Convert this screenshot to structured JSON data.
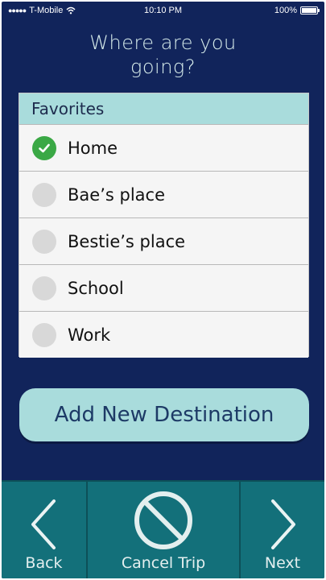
{
  "status": {
    "carrier": "T-Mobile",
    "time": "10:10 PM",
    "battery": "100%"
  },
  "header": {
    "title_line1": "Where are you",
    "title_line2": "going?"
  },
  "favorites": {
    "heading": "Favorites",
    "items": [
      {
        "label": "Home",
        "selected": true
      },
      {
        "label": "Bae’s place",
        "selected": false
      },
      {
        "label": "Bestie’s place",
        "selected": false
      },
      {
        "label": "School",
        "selected": false
      },
      {
        "label": "Work",
        "selected": false
      }
    ]
  },
  "actions": {
    "add_destination": "Add New Destination"
  },
  "nav": {
    "back": "Back",
    "cancel": "Cancel Trip",
    "next": "Next"
  },
  "colors": {
    "background": "#11245b",
    "accent": "#a9dcdc",
    "selected": "#3aa845",
    "bottom_bar": "#13707a"
  }
}
